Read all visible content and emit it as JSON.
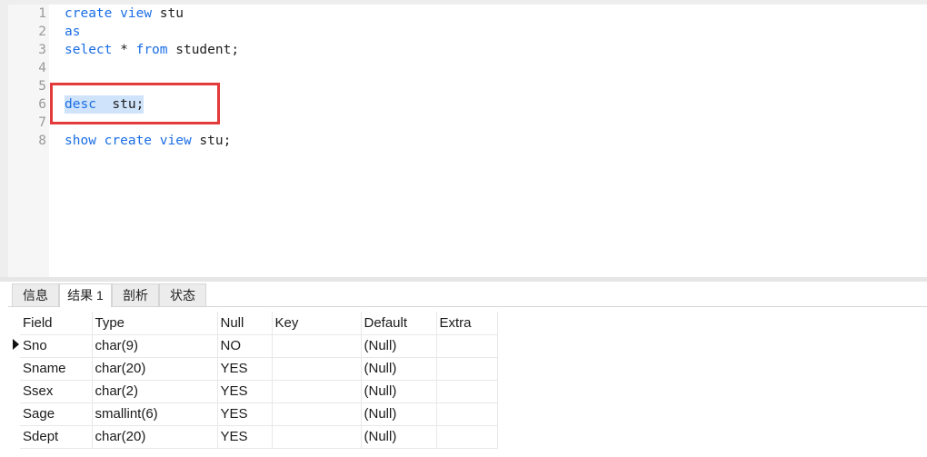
{
  "editor": {
    "lines": [
      {
        "n": "1",
        "parts": [
          {
            "t": "create",
            "k": true
          },
          {
            "t": " ",
            "k": false
          },
          {
            "t": "view",
            "k": true
          },
          {
            "t": " stu",
            "k": false
          }
        ]
      },
      {
        "n": "2",
        "parts": [
          {
            "t": "as",
            "k": true
          }
        ]
      },
      {
        "n": "3",
        "parts": [
          {
            "t": "select",
            "k": true
          },
          {
            "t": " * ",
            "k": false
          },
          {
            "t": "from",
            "k": true
          },
          {
            "t": " student;",
            "k": false
          }
        ]
      },
      {
        "n": "4",
        "parts": []
      },
      {
        "n": "5",
        "parts": []
      },
      {
        "n": "6",
        "parts": [
          {
            "t": "desc",
            "k": true
          },
          {
            "t": "  stu;",
            "k": false
          }
        ],
        "selected": true
      },
      {
        "n": "7",
        "parts": []
      },
      {
        "n": "8",
        "parts": [
          {
            "t": "show",
            "k": true
          },
          {
            "t": " ",
            "k": false
          },
          {
            "t": "create",
            "k": true
          },
          {
            "t": " ",
            "k": false
          },
          {
            "t": "view",
            "k": true
          },
          {
            "t": " stu;",
            "k": false
          }
        ]
      }
    ]
  },
  "tabs": [
    {
      "label": "信息",
      "active": false
    },
    {
      "label": "结果 1",
      "active": true
    },
    {
      "label": "剖析",
      "active": false
    },
    {
      "label": "状态",
      "active": false
    }
  ],
  "grid": {
    "columns": [
      "Field",
      "Type",
      "Null",
      "Key",
      "Default",
      "Extra"
    ],
    "rows": [
      [
        "Sno",
        "char(9)",
        "NO",
        "",
        "(Null)",
        ""
      ],
      [
        "Sname",
        "char(20)",
        "YES",
        "",
        "(Null)",
        ""
      ],
      [
        "Ssex",
        "char(2)",
        "YES",
        "",
        "(Null)",
        ""
      ],
      [
        "Sage",
        "smallint(6)",
        "YES",
        "",
        "(Null)",
        ""
      ],
      [
        "Sdept",
        "char(20)",
        "YES",
        "",
        "(Null)",
        ""
      ]
    ]
  },
  "colors": {
    "keyword": "#1a6ee6",
    "highlight_box": "#e33b3b",
    "selection": "#cfe3fb"
  }
}
